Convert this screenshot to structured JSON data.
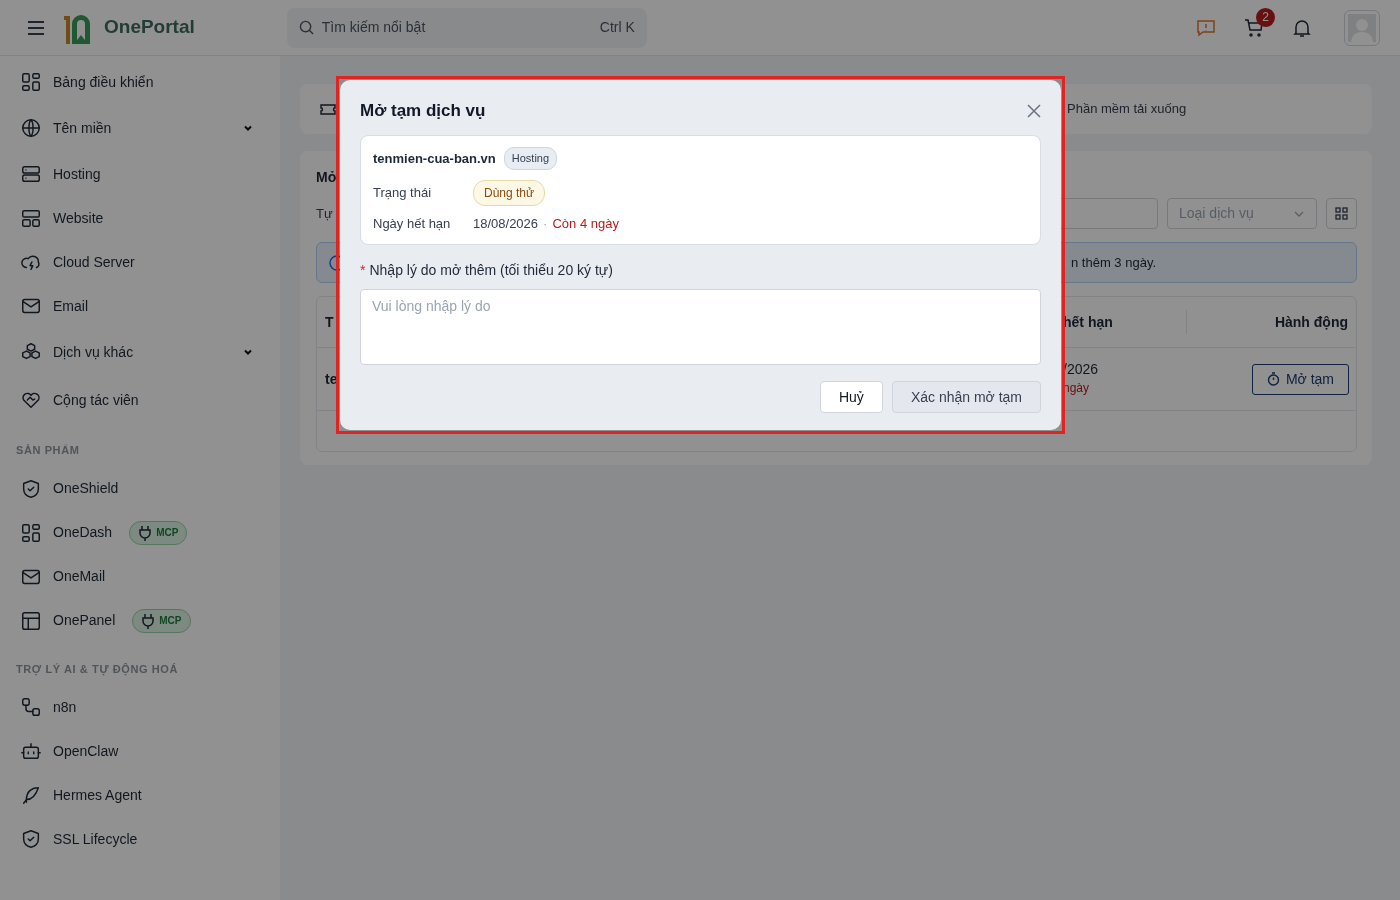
{
  "header": {
    "brand": "OnePortal",
    "search": {
      "placeholder": "Tìm kiếm nổi bật",
      "shortcut": "Ctrl K"
    },
    "cart_count": "2"
  },
  "sidebar": {
    "sections": [
      {
        "items": [
          {
            "label": "Bảng điều khiển",
            "has_submenu": false
          },
          {
            "label": "Tên miền",
            "has_submenu": true
          },
          {
            "label": "Hosting",
            "has_submenu": false
          },
          {
            "label": "Website",
            "has_submenu": false
          },
          {
            "label": "Cloud Server",
            "has_submenu": false
          },
          {
            "label": "Email",
            "has_submenu": false
          },
          {
            "label": "Dịch vụ khác",
            "has_submenu": true
          },
          {
            "label": "Cộng tác viên",
            "has_submenu": false
          }
        ]
      },
      {
        "title": "SẢN PHẨM",
        "items": [
          {
            "label": "OneShield",
            "has_submenu": false
          },
          {
            "label": "OneDash",
            "has_submenu": false,
            "badge": "MCP"
          },
          {
            "label": "OneMail",
            "has_submenu": false
          },
          {
            "label": "OnePanel",
            "has_submenu": false,
            "badge": "MCP"
          }
        ]
      },
      {
        "title": "TRỢ LÝ AI & TỰ ĐỘNG HOÁ",
        "items": [
          {
            "label": "n8n",
            "has_submenu": false
          },
          {
            "label": "OpenClaw",
            "has_submenu": false
          },
          {
            "label": "Hermes Agent",
            "has_submenu": false
          },
          {
            "label": "SSL Lifecycle",
            "has_submenu": false
          }
        ]
      }
    ]
  },
  "page": {
    "download_link": "Phần mềm tải xuống",
    "panel_title": "Mở",
    "filter_label": "Tự",
    "type_select": {
      "placeholder": "Loại dịch vụ"
    },
    "alert_text": "n thêm 3 ngày.",
    "table": {
      "columns": [
        "T",
        "hết hạn",
        "Hành động"
      ],
      "rows": [
        {
          "name": "te",
          "expiry": "/2026",
          "remaining": "ngày",
          "action": "Mở tạm"
        }
      ]
    }
  },
  "modal": {
    "title": "Mở tạm dịch vụ",
    "highlighted": true,
    "service": {
      "domain": "tenmien-cua-ban.vn",
      "type": "Hosting",
      "status_label": "Trạng thái",
      "status": "Dùng thử",
      "expiry_label": "Ngày hết hạn",
      "expiry_date": "18/08/2026",
      "separator": "·",
      "remaining": "Còn 4 ngày"
    },
    "reason": {
      "label": "Nhập lý do mở thêm (tối thiểu 20 ký tự)",
      "required_mark": "*",
      "placeholder": "Vui lòng nhập lý do"
    },
    "buttons": [
      {
        "label": "Huỷ",
        "kind": "secondary"
      },
      {
        "label": "Xác nhận mở tạm",
        "kind": "primary",
        "disabled": true
      }
    ]
  }
}
